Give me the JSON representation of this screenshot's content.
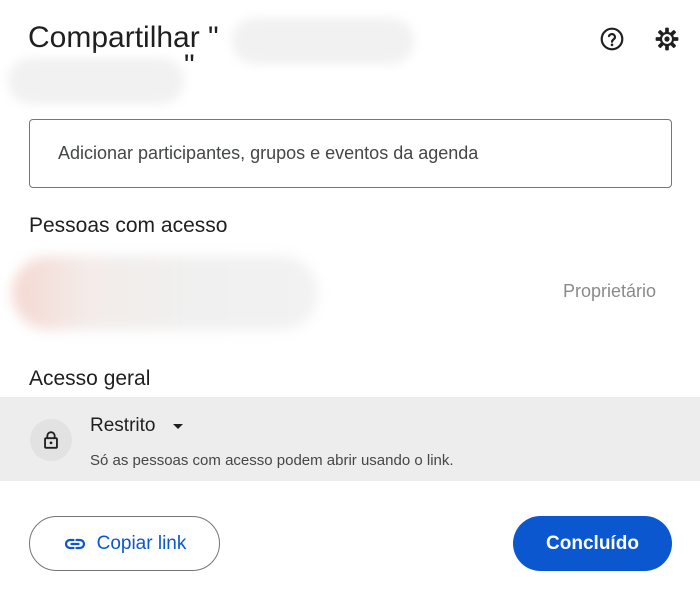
{
  "dialog": {
    "title_prefix": "Compartilhar \"",
    "title_line2": "\"",
    "icons": {
      "help": "help-icon",
      "settings": "gear-icon",
      "lock": "lock-icon",
      "link": "link-icon",
      "dropdown": "caret-down-icon"
    }
  },
  "add_people": {
    "placeholder": "Adicionar participantes, grupos e eventos da agenda"
  },
  "people_with_access": {
    "heading": "Pessoas com acesso",
    "owner_role": "Proprietário"
  },
  "general_access": {
    "heading": "Acesso geral",
    "selected": "Restrito",
    "description": "Só as pessoas com acesso podem abrir usando o link."
  },
  "footer": {
    "copy_link": "Copiar link",
    "done": "Concluído"
  },
  "colors": {
    "primary": "#0b57d0",
    "access_bg": "#ededed",
    "border": "#747775",
    "text": "#1f1f1f"
  }
}
